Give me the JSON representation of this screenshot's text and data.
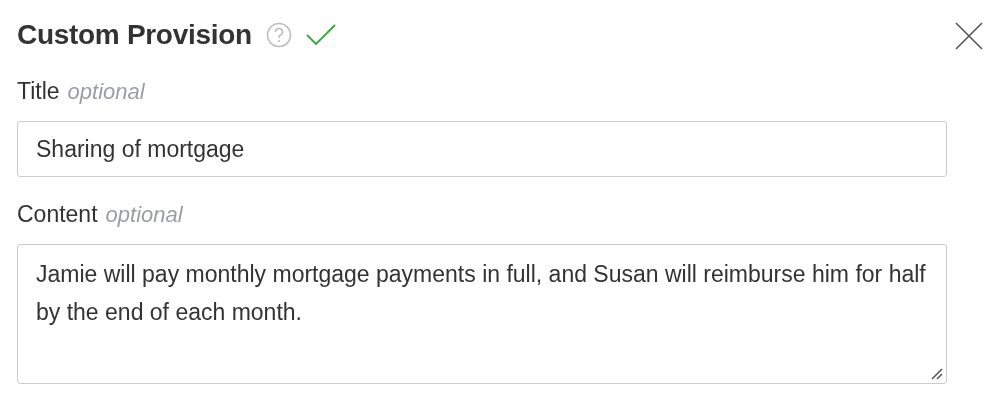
{
  "dialog": {
    "title": "Custom Provision"
  },
  "fields": [
    {
      "kind": "input",
      "label": "Title",
      "hint": "optional",
      "value": "Sharing of mortgage"
    },
    {
      "kind": "textarea",
      "label": "Content",
      "hint": "optional",
      "value": "Jamie will pay monthly mortgage payments in full, and Susan will reimburse him for half by the end of each month."
    }
  ]
}
